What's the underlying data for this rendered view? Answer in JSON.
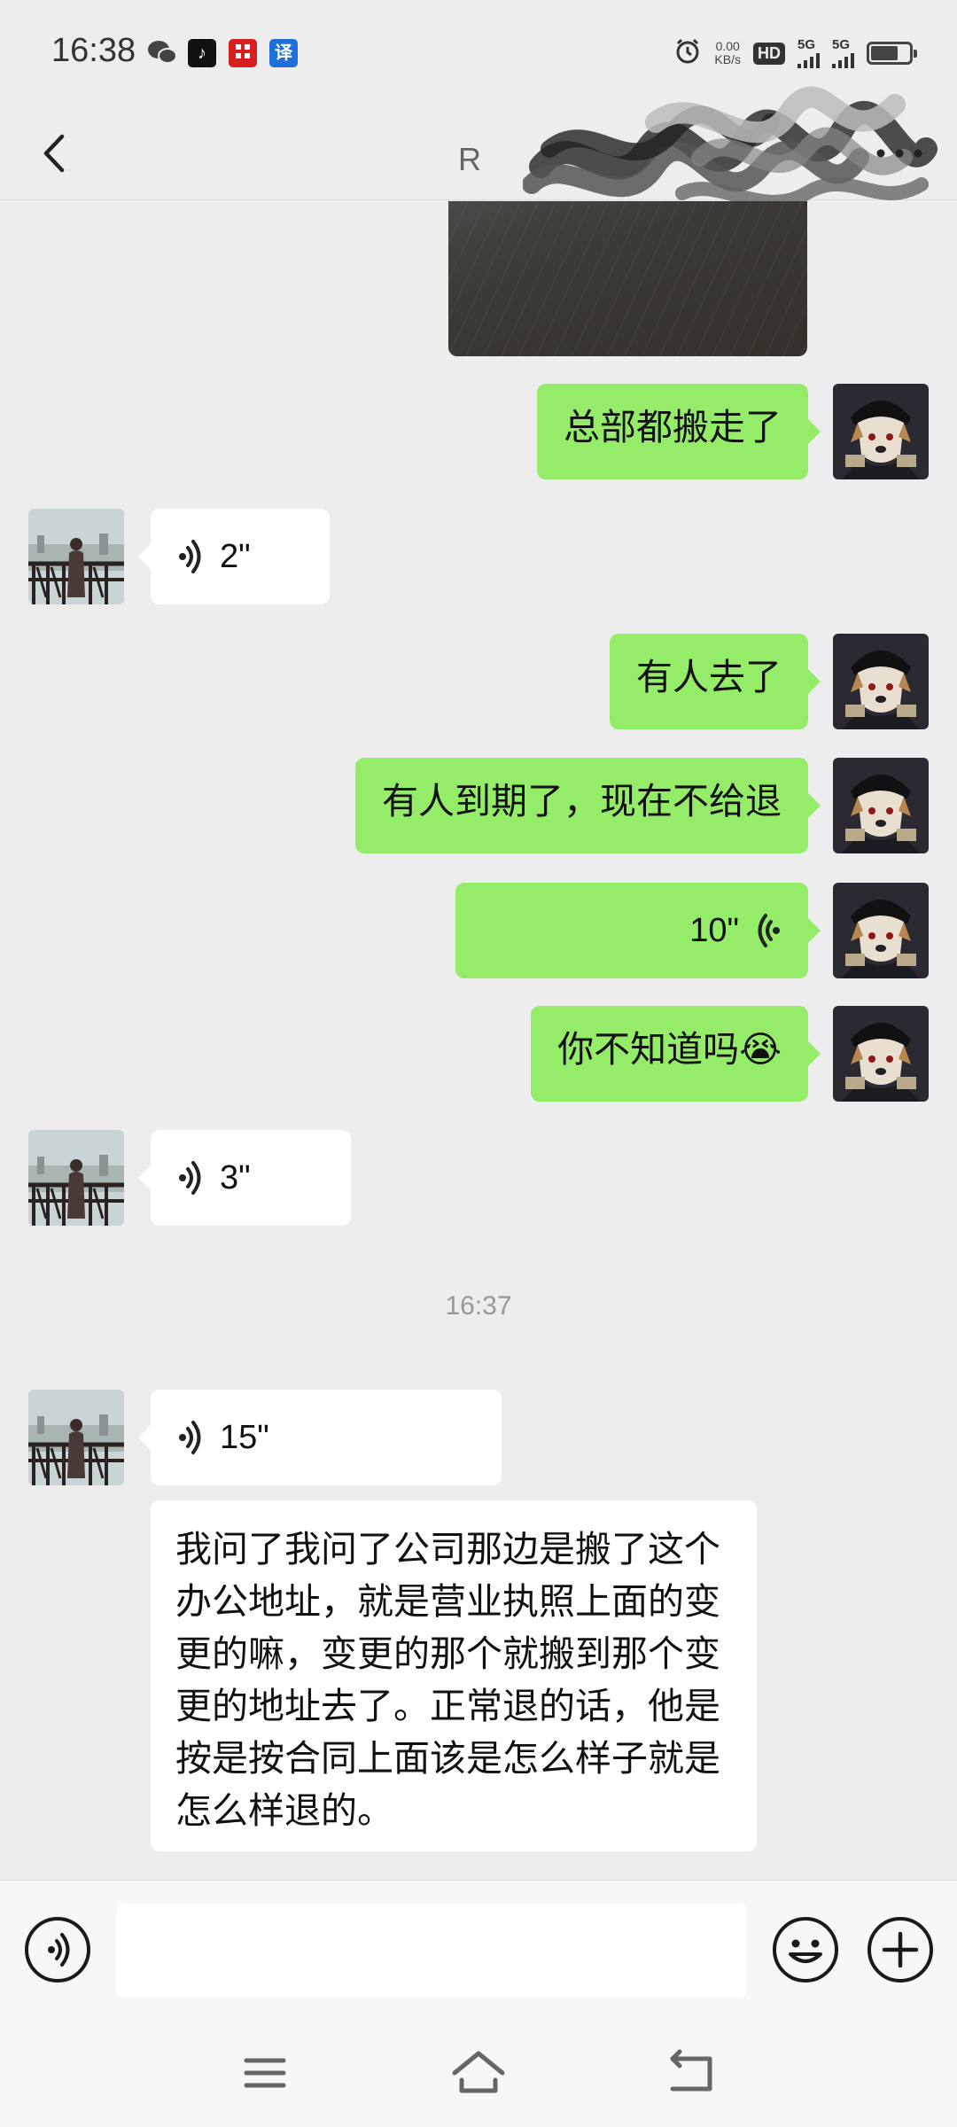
{
  "status_bar": {
    "time": "16:38",
    "net_speed_value": "0.00",
    "net_speed_unit": "KB/s",
    "hd_label": "HD",
    "sim1_label": "5G",
    "sim2_label": "5G",
    "apps": [
      "wechat-icon",
      "tiktok-icon",
      "news-app-icon",
      "translate-app-icon"
    ],
    "translate_glyph": "译"
  },
  "header": {
    "title": "R"
  },
  "messages": [
    {
      "side": "self",
      "type": "image"
    },
    {
      "side": "self",
      "type": "text",
      "text": "总部都搬走了"
    },
    {
      "side": "other",
      "type": "voice",
      "duration": "2\""
    },
    {
      "side": "self",
      "type": "text",
      "text": "有人去了"
    },
    {
      "side": "self",
      "type": "text",
      "text": "有人到期了，现在不给退"
    },
    {
      "side": "self",
      "type": "voice",
      "duration": "10\""
    },
    {
      "side": "self",
      "type": "text",
      "text": "你不知道吗😭"
    },
    {
      "side": "other",
      "type": "voice",
      "duration": "3\""
    },
    {
      "side": "system",
      "type": "time",
      "text": "16:37"
    },
    {
      "side": "other",
      "type": "voice",
      "duration": "15\""
    },
    {
      "side": "other",
      "type": "text",
      "text": "我问了我问了公司那边是搬了这个办公地址，就是营业执照上面的变更的嘛，变更的那个就搬到那个变更的地址去了。正常退的话，他是按是按合同上面该是怎么样子就是怎么样退的。"
    }
  ],
  "input_bar": {
    "value": ""
  },
  "colors": {
    "self_bubble": "#95ec69",
    "other_bubble": "#ffffff",
    "background": "#ededed"
  }
}
